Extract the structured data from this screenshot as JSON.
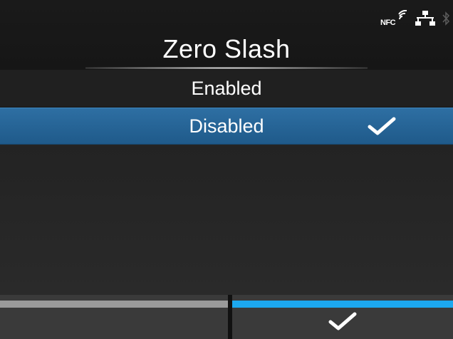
{
  "header": {
    "title": "Zero Slash",
    "status_icons": {
      "nfc_label": "NFC",
      "nfc_icon": "nfc-icon",
      "network_icon": "network-icon",
      "bluetooth_icon": "bluetooth-icon"
    }
  },
  "options": [
    {
      "label": "Enabled",
      "selected": false
    },
    {
      "label": "Disabled",
      "selected": true,
      "check_icon": "checkmark-icon"
    }
  ],
  "softkeys": {
    "left": {
      "label": "",
      "accent": "#9a9a9a"
    },
    "right": {
      "label": "",
      "icon": "checkmark-icon",
      "accent": "#1ca8ef"
    }
  },
  "colors": {
    "background": "#262626",
    "selected_row": "#2469a0",
    "accent_blue": "#1ca8ef",
    "accent_gray": "#9a9a9a"
  }
}
